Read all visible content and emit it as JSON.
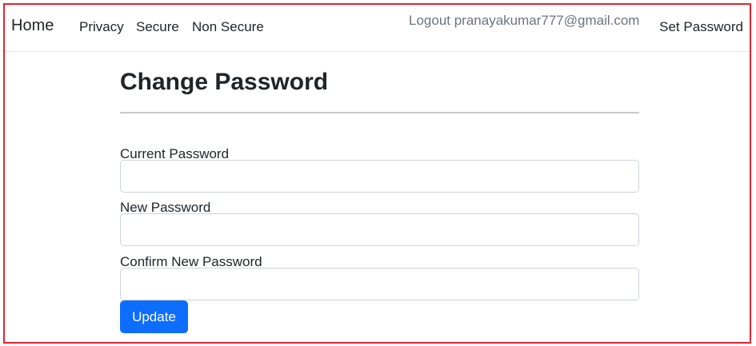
{
  "navbar": {
    "brand": "Home",
    "links": {
      "privacy": "Privacy",
      "secure": "Secure",
      "non_secure": "Non Secure"
    },
    "logout": "Logout pranayakumar777@gmail.com",
    "set_password": "Set Password"
  },
  "form": {
    "title": "Change Password",
    "current_password": {
      "label": "Current Password",
      "value": "",
      "placeholder": ""
    },
    "new_password": {
      "label": "New Password",
      "value": "",
      "placeholder": ""
    },
    "confirm_password": {
      "label": "Confirm New Password",
      "value": "",
      "placeholder": ""
    },
    "submit_label": "Update"
  },
  "colors": {
    "frame_border": "#e0232f",
    "primary_button": "#0d6efd",
    "logout_text": "#6c757d"
  }
}
